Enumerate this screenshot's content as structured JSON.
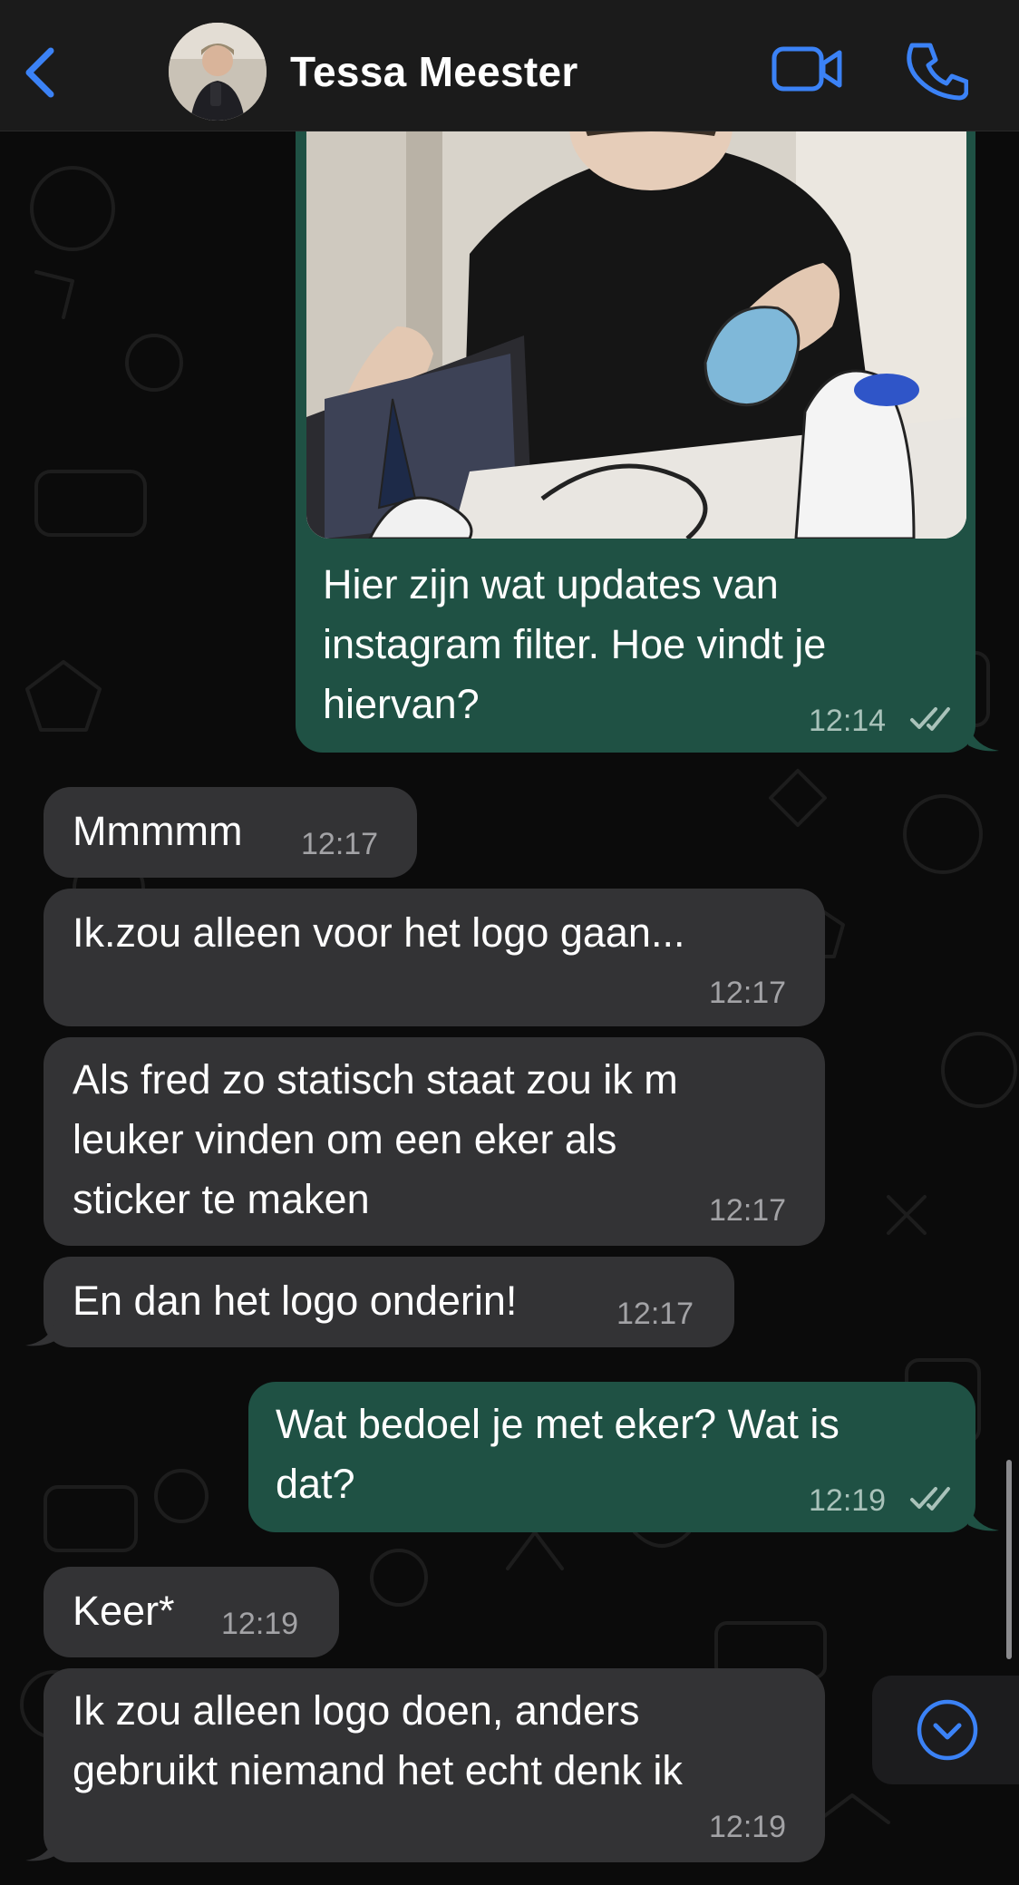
{
  "header": {
    "contact_name": "Tessa Meester",
    "back_icon": "chevron-left-icon",
    "video_icon": "video-camera-icon",
    "call_icon": "phone-icon",
    "accent_color": "#3b82f6"
  },
  "messages": [
    {
      "direction": "outgoing",
      "has_image": true,
      "lines": [
        "Hier zijn wat updates van",
        "instagram filter. Hoe vindt je",
        "hiervan?"
      ],
      "time": "12:14",
      "status": "read"
    },
    {
      "direction": "incoming",
      "lines": [
        "Mmmmm"
      ],
      "time": "12:17"
    },
    {
      "direction": "incoming",
      "lines": [
        "Ik.zou alleen voor het logo gaan..."
      ],
      "time": "12:17"
    },
    {
      "direction": "incoming",
      "lines": [
        "Als fred zo statisch staat zou ik m",
        "leuker vinden om een eker als",
        "sticker te maken"
      ],
      "time": "12:17"
    },
    {
      "direction": "incoming",
      "lines": [
        "En dan het logo onderin!"
      ],
      "time": "12:17"
    },
    {
      "direction": "outgoing",
      "lines": [
        "Wat bedoel je met eker? Wat is",
        "dat?"
      ],
      "time": "12:19",
      "status": "read"
    },
    {
      "direction": "incoming",
      "lines": [
        "Keer*"
      ],
      "time": "12:19"
    },
    {
      "direction": "incoming",
      "lines": [
        "Ik zou alleen logo doen, anders",
        "gebruikt niemand het echt denk ik"
      ],
      "time": "12:19"
    }
  ],
  "scroll_down_icon": "chevron-down-circle-icon",
  "colors": {
    "incoming_bubble": "#333335",
    "outgoing_bubble": "#1f5144",
    "background": "#0b0b0b"
  }
}
